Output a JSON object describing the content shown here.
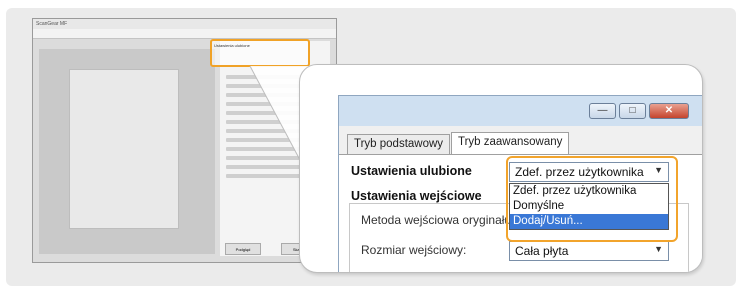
{
  "thumbnail": {
    "title": "ScanGear MF",
    "favorite_label": "Ustawienia ulubione",
    "favorite_value": "Zdef. przez użytkownika",
    "dropdown_items": [
      "Zdef. przez użytkownika",
      "Domyślne",
      "Dodaj/Usuń..."
    ],
    "preview_button": "Podgląd",
    "scan_button": "Skanuj"
  },
  "callout": {
    "window": {
      "minimize_icon": "minimize-icon",
      "maximize_icon": "maximize-icon",
      "close_icon": "close-icon",
      "min_glyph": "—",
      "max_glyph": "□",
      "close_glyph": "✕"
    },
    "tabs": [
      {
        "label": "Tryb podstawowy",
        "active": false
      },
      {
        "label": "Tryb zaawansowany",
        "active": true
      }
    ],
    "favorite": {
      "label": "Ustawienia ulubione",
      "value": "Zdef. przez użytkownika"
    },
    "dropdown": {
      "items": [
        "Zdef. przez użytkownika",
        "Domyślne",
        "Dodaj/Usuń..."
      ],
      "highlighted_index": 2
    },
    "input_settings": {
      "section_label": "Ustawienia wejściowe",
      "input_method_label": "Metoda wejściowa oryginału",
      "input_size_label": "Rozmiar wejściowy:",
      "input_size_value": "Cała płyta"
    }
  },
  "colors": {
    "highlight": "#f2a42c",
    "selection": "#3a78d6",
    "window_frame": "#cfe0f1"
  }
}
